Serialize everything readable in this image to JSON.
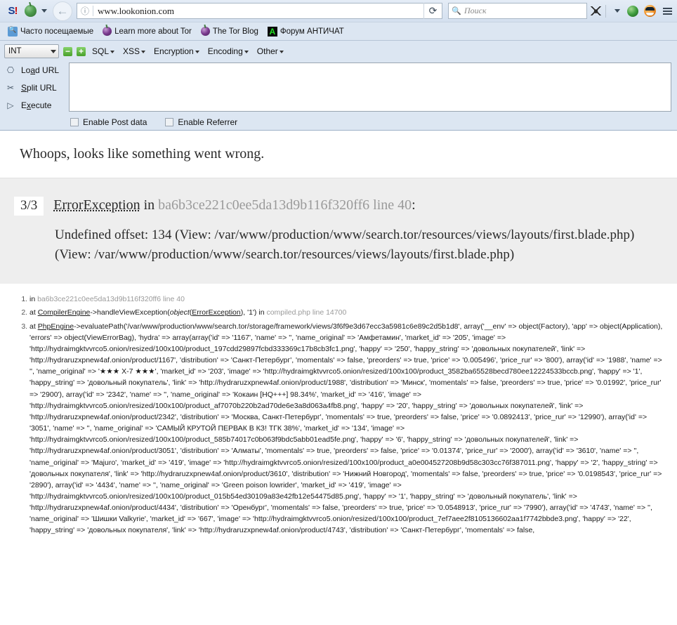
{
  "browser": {
    "logo_label": "S!",
    "onion_menu_icon": "onion-icon",
    "back_icon": "back-arrow-icon",
    "identity_icon": "info-icon",
    "url": "www.lookonion.com",
    "reload_icon": "reload-icon",
    "search_icon": "search-icon",
    "search_placeholder": "Поиск",
    "noscript_icon": "noscript-icon",
    "addon_caret_icon": "chevron-down-icon",
    "addon_green_icon": "torbutton-icon",
    "addon_orange_icon": "tor-user-icon",
    "menu_icon": "hamburger-menu-icon",
    "bookmarks": [
      {
        "label": "Часто посещаемые",
        "icon": "bookmark-folder-icon"
      },
      {
        "label": "Learn more about Tor",
        "icon": "onion-icon"
      },
      {
        "label": "The Tor Blog",
        "icon": "onion-icon"
      },
      {
        "label": "Форум АНТИЧАТ",
        "icon": "antichat-icon"
      }
    ]
  },
  "hackbar": {
    "select_value": "INT",
    "minus_label": "−",
    "plus_label": "+",
    "menus": [
      "SQL",
      "XSS",
      "Encryption",
      "Encoding",
      "Other"
    ],
    "actions": [
      {
        "label_pre": "Lo",
        "label_key": "a",
        "label_post": "d URL",
        "icon": "load-url-icon"
      },
      {
        "label_pre": "",
        "label_key": "S",
        "label_post": "plit URL",
        "icon": "split-url-icon"
      },
      {
        "label_pre": "E",
        "label_key": "x",
        "label_post": "ecute",
        "icon": "execute-icon"
      }
    ],
    "textarea_value": "",
    "checkbox_post_data": "Enable Post data",
    "checkbox_referrer": "Enable Referrer"
  },
  "page": {
    "whoops": "Whoops, looks like something went wrong.",
    "exception": {
      "badge": "3/3",
      "name": "ErrorException",
      "in_word": "in",
      "file": "ba6b3ce221c0ee5da13d9b116f320ff6 line 40",
      "colon": ":",
      "message": "Undefined offset: 134 (View: /var/www/production/www/search.tor/resources/views/layouts/first.blade.php) (View: /var/www/production/www/search.tor/resources/views/layouts/first.blade.php)"
    },
    "trace": {
      "item1": {
        "prefix": "in ",
        "file": "ba6b3ce221c0ee5da13d9b116f320ff6 line 40"
      },
      "item2": {
        "prefix": "at ",
        "class": "CompilerEngine",
        "arrow": "->",
        "method": "handleViewException(",
        "arg_object": "object",
        "arg_open": "(",
        "arg_class": "ErrorException",
        "arg_close": "), '1')",
        "in_word": " in ",
        "file": "compiled.php line 14700"
      },
      "item3": {
        "prefix": "at ",
        "class": "PhpEngine",
        "arrow": "->",
        "method": "evaluatePath('/var/www/production/www/search.tor/storage/framework/views/3f6f9e3d67ecc3a5981c6e89c2d5b1d8', ",
        "dump": "array('__env' => object(Factory), 'app' => object(Application), 'errors' => object(ViewErrorBag), 'hydra' => array(array('id' => '1167', 'name' => '', 'name_original' => 'Амфетамин', 'market_id' => '205', 'image' => 'http://hydraimgktvvrco5.onion/resized/100x100/product_197cdd29897fcbd333369c17b8cb3fc1.png', 'happy' => '250', 'happy_string' => 'довольных покупателей', 'link' => 'http://hydraruzxpnew4af.onion/product/1167', 'distribution' => 'Санкт-Петербург', 'momentals' => false, 'preorders' => true, 'price' => '0.005496', 'price_rur' => '800'), array('id' => '1988', 'name' => '', 'name_original' => '★★★ X-7 ★★★', 'market_id' => '203', 'image' => 'http://hydraimgktvvrco5.onion/resized/100x100/product_3582ba65528becd780ee12224533bccb.png', 'happy' => '1', 'happy_string' => 'довольный покупатель', 'link' => 'http://hydraruzxpnew4af.onion/product/1988', 'distribution' => 'Минск', 'momentals' => false, 'preorders' => true, 'price' => '0.01992', 'price_rur' => '2900'), array('id' => '2342', 'name' => '', 'name_original' => 'Кокаин [HQ+++] 98.34%', 'market_id' => '416', 'image' => 'http://hydraimgktvvrco5.onion/resized/100x100/product_af7070b220b2ad70de6e3a8d063a4fb8.png', 'happy' => '20', 'happy_string' => 'довольных покупателей', 'link' => 'http://hydraruzxpnew4af.onion/product/2342', 'distribution' => 'Москва, Санкт-Петербург', 'momentals' => true, 'preorders' => false, 'price' => '0.0892413', 'price_rur' => '12990'), array('id' => '3051', 'name' => '', 'name_original' => 'САМЫЙ КРУТОЙ ПЕРВАК В КЗ! ТГК 38%', 'market_id' => '134', 'image' => 'http://hydraimgktvvrco5.onion/resized/100x100/product_585b74017c0b063f9bdc5abb01ead5fe.png', 'happy' => '6', 'happy_string' => 'довольных покупателей', 'link' => 'http://hydraruzxpnew4af.onion/product/3051', 'distribution' => 'Алматы', 'momentals' => true, 'preorders' => false, 'price' => '0.01374', 'price_rur' => '2000'), array('id' => '3610', 'name' => '', 'name_original' => 'Majuro', 'market_id' => '419', 'image' => 'http://hydraimgktvvrco5.onion/resized/100x100/product_a0e004527208b9d58c303cc76f387011.png', 'happy' => '2', 'happy_string' => 'довольных покупателя', 'link' => 'http://hydraruzxpnew4af.onion/product/3610', 'distribution' => 'Нижний Новгород', 'momentals' => false, 'preorders' => true, 'price' => '0.0198543', 'price_rur' => '2890'), array('id' => '4434', 'name' => '', 'name_original' => 'Green poison lowrider', 'market_id' => '419', 'image' => 'http://hydraimgktvvrco5.onion/resized/100x100/product_015b54ed30109a83e42fb12e54475d85.png', 'happy' => '1', 'happy_string' => 'довольный покупатель', 'link' => 'http://hydraruzxpnew4af.onion/product/4434', 'distribution' => 'Оренбург', 'momentals' => false, 'preorders' => true, 'price' => '0.0548913', 'price_rur' => '7990'), array('id' => '4743', 'name' => '', 'name_original' => 'Шишки Valkyrie', 'market_id' => '667', 'image' => 'http://hydraimgktvvrco5.onion/resized/100x100/product_7ef7aee2f8105136602aa1f7742bbde3.png', 'happy' => '22', 'happy_string' => 'довольных покупателя', 'link' => 'http://hydraruzxpnew4af.onion/product/4743', 'distribution' => 'Санкт-Петербург', 'momentals' => false,"
      }
    }
  }
}
